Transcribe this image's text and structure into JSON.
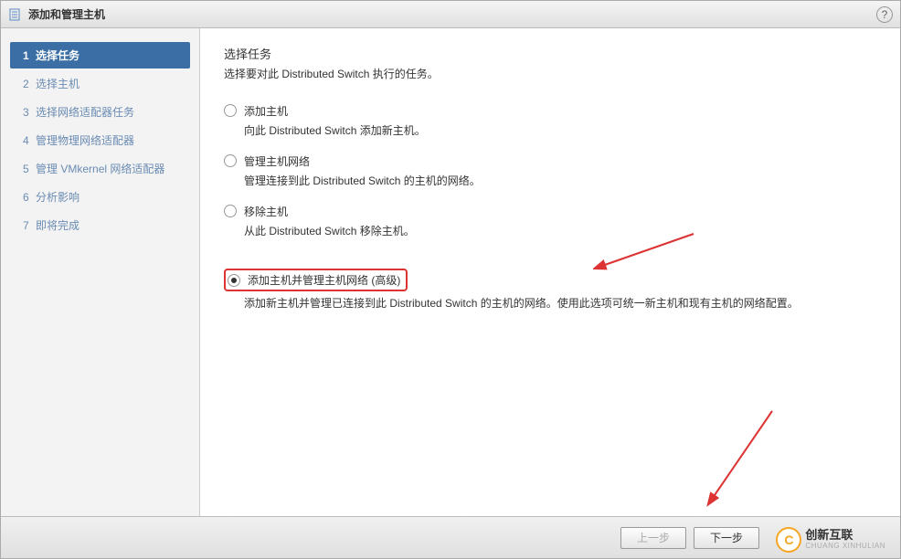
{
  "title": "添加和管理主机",
  "help_icon": "?",
  "sidebar": {
    "steps": [
      {
        "num": "1",
        "label": "选择任务"
      },
      {
        "num": "2",
        "label": "选择主机"
      },
      {
        "num": "3",
        "label": "选择网络适配器任务"
      },
      {
        "num": "4",
        "label": "管理物理网络适配器"
      },
      {
        "num": "5",
        "label": "管理 VMkernel 网络适配器"
      },
      {
        "num": "6",
        "label": "分析影响"
      },
      {
        "num": "7",
        "label": "即将完成"
      }
    ]
  },
  "main": {
    "title": "选择任务",
    "subtitle": "选择要对此 Distributed Switch 执行的任务。",
    "options": [
      {
        "label": "添加主机",
        "desc": "向此 Distributed Switch 添加新主机。"
      },
      {
        "label": "管理主机网络",
        "desc": "管理连接到此 Distributed Switch 的主机的网络。"
      },
      {
        "label": "移除主机",
        "desc": "从此 Distributed Switch 移除主机。"
      },
      {
        "label": "添加主机并管理主机网络 (高级)",
        "desc": "添加新主机并管理已连接到此 Distributed Switch 的主机的网络。使用此选项可统一新主机和现有主机的网络配置。"
      }
    ]
  },
  "footer": {
    "back": "上一步",
    "next": "下一步"
  },
  "logo": {
    "cn": "创新互联",
    "en": "CHUANG XINHULIAN"
  }
}
